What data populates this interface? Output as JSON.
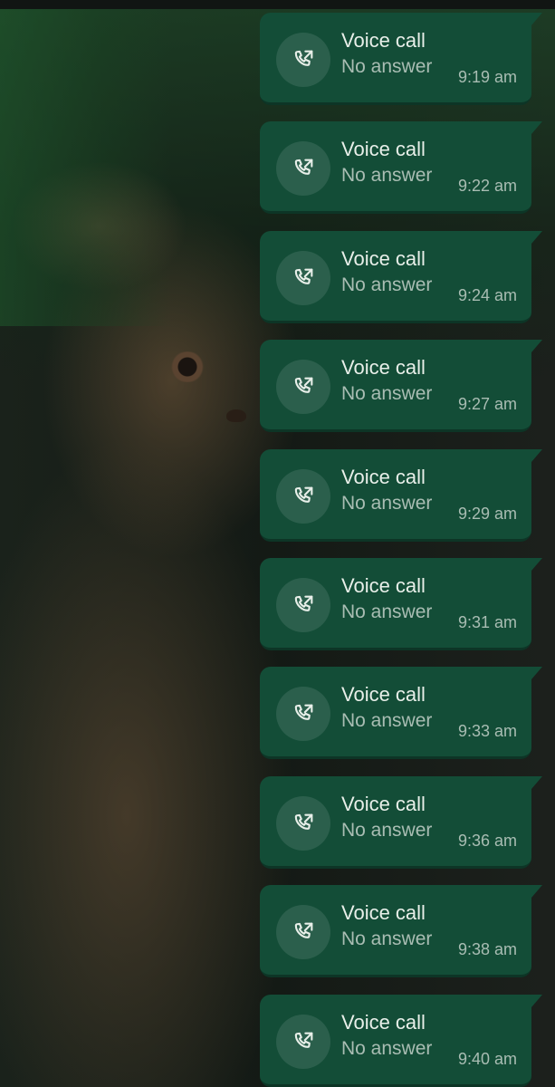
{
  "calls": [
    {
      "title": "Voice call",
      "status": "No answer",
      "time": "9:19 am"
    },
    {
      "title": "Voice call",
      "status": "No answer",
      "time": "9:22 am"
    },
    {
      "title": "Voice call",
      "status": "No answer",
      "time": "9:24 am"
    },
    {
      "title": "Voice call",
      "status": "No answer",
      "time": "9:27 am"
    },
    {
      "title": "Voice call",
      "status": "No answer",
      "time": "9:29 am"
    },
    {
      "title": "Voice call",
      "status": "No answer",
      "time": "9:31 am"
    },
    {
      "title": "Voice call",
      "status": "No answer",
      "time": "9:33 am"
    },
    {
      "title": "Voice call",
      "status": "No answer",
      "time": "9:36 am"
    },
    {
      "title": "Voice call",
      "status": "No answer",
      "time": "9:38 am"
    },
    {
      "title": "Voice call",
      "status": "No answer",
      "time": "9:40 am"
    }
  ],
  "icons": {
    "call": "outgoing-call-icon"
  },
  "colors": {
    "bubble": "#134d37",
    "icon_circle": "#2b5f4c",
    "primary_text": "#e8efe9",
    "secondary_text": "#a9bdb3"
  }
}
